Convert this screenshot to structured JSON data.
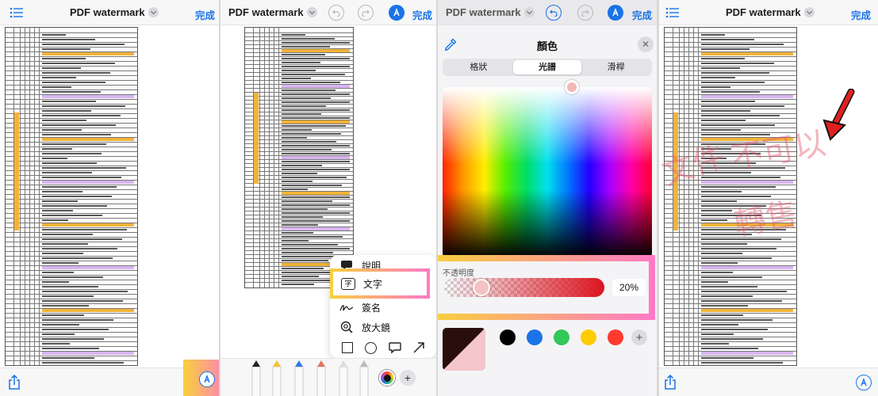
{
  "app": {
    "title": "PDF watermark",
    "done_label": "完成"
  },
  "panel2": {
    "menu": {
      "item_description": "說明",
      "item_text": "文字",
      "item_signature": "簽名",
      "item_magnifier": "放大鏡"
    },
    "text_item_glyph": "字"
  },
  "panel3": {
    "sheet_title": "顏色",
    "segments": {
      "grid": "格狀",
      "spectrum": "光譜",
      "sliders": "滑桿",
      "selected": "光譜"
    },
    "opacity_label": "不透明度",
    "opacity_value": "20%",
    "opacity_fraction": 0.2,
    "selected_color": "#1c0a0a",
    "swatches": [
      "#000000",
      "#1a73e8",
      "#34c759",
      "#ffcc00",
      "#ff3b30"
    ]
  },
  "panel4": {
    "watermark_lines": [
      "文件",
      "不可以",
      "轉售"
    ],
    "watermark_color": "#e55a6e"
  },
  "colors": {
    "accent": "#1a73e8",
    "highlight_gradient": [
      "#f7d03c",
      "#ff79c6"
    ],
    "arrow": "#e02020"
  }
}
